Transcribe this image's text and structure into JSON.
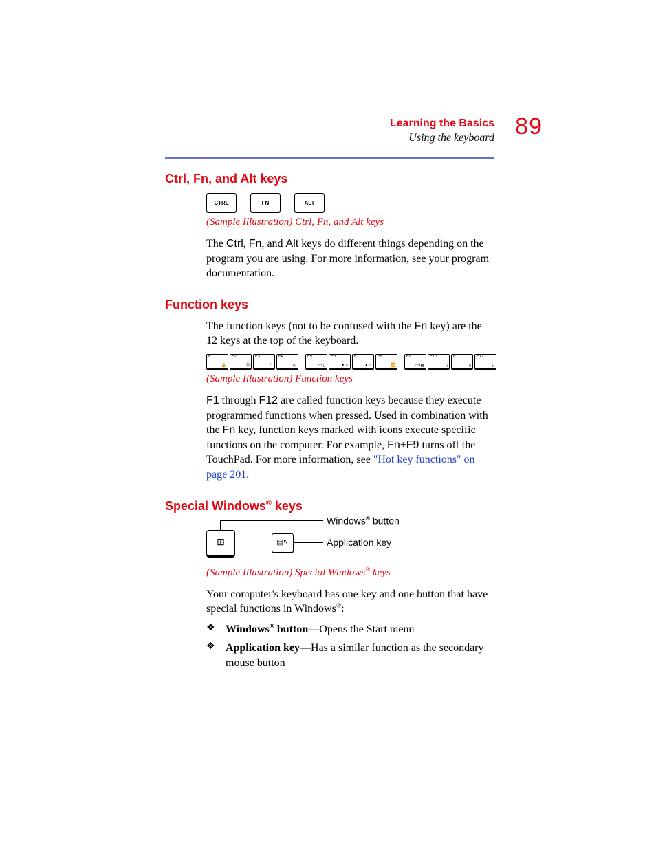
{
  "header": {
    "chapter": "Learning the Basics",
    "section": "Using the keyboard",
    "page_number": "89"
  },
  "section1": {
    "heading": "Ctrl, Fn, and Alt keys",
    "keys": {
      "ctrl": "CTRL",
      "fn": "FN",
      "alt": "ALT"
    },
    "caption": "(Sample Illustration) Ctrl, Fn, and Alt keys",
    "body_pre": "The ",
    "body_k1": "Ctrl",
    "body_mid1": ", ",
    "body_k2": "Fn",
    "body_mid2": ", and ",
    "body_k3": "Alt",
    "body_post": " keys do different things depending on the program you are using. For more information, see your program documentation."
  },
  "section2": {
    "heading": "Function keys",
    "intro_pre": "The function keys (not to be confused with the ",
    "intro_k": "Fn",
    "intro_post": " key) are the 12 keys at the top of the keyboard.",
    "fkeys": [
      "F1",
      "F2",
      "F3",
      "F4",
      "F5",
      "F6",
      "F7",
      "F8",
      "F9",
      "F10",
      "F11",
      "F12"
    ],
    "caption": "(Sample Illustration) Function keys",
    "body_k1": "F1",
    "body_mid1": " through ",
    "body_k2": "F12",
    "body_mid2": " are called function keys because they execute programmed functions when pressed. Used in combination with the ",
    "body_k3": "Fn",
    "body_mid3": " key, function keys marked with icons execute specific functions on the computer. For example, ",
    "body_k4": "Fn",
    "body_plus": "+",
    "body_k5": "F9",
    "body_mid4": " turns off the TouchPad. For more information, see ",
    "link_text": "\"Hot key functions\" on page 201",
    "body_end": "."
  },
  "section3": {
    "heading_pre": "Special Windows",
    "heading_sup": "®",
    "heading_post": " keys",
    "label_windows_pre": "Windows",
    "label_windows_sup": "®",
    "label_windows_post": " button",
    "label_app": "Application key",
    "caption_pre": "(Sample Illustration) Special Windows",
    "caption_sup": "®",
    "caption_post": " keys",
    "intro_pre": "Your computer's keyboard has one key and one button that have special functions in Windows",
    "intro_sup": "®",
    "intro_post": ":",
    "bullet1_strong_pre": "Windows",
    "bullet1_strong_sup": "®",
    "bullet1_strong_post": " button",
    "bullet1_rest": "—Opens the Start menu",
    "bullet2_strong": "Application key",
    "bullet2_rest": "—Has a similar function as the secondary mouse button"
  }
}
